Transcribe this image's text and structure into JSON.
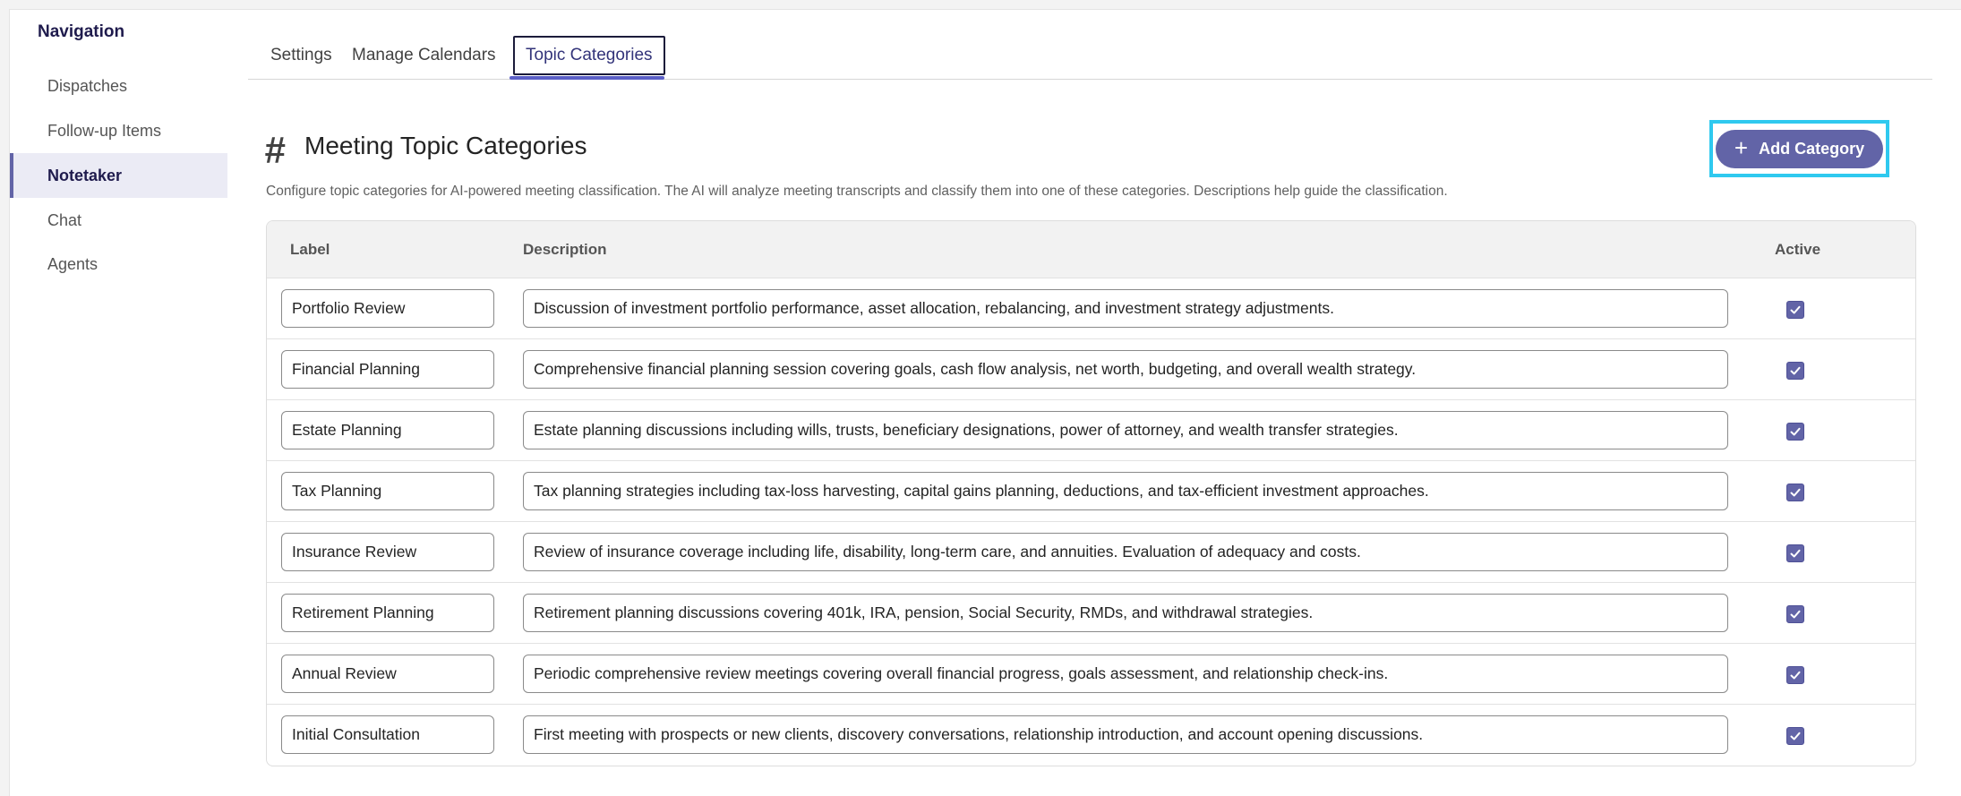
{
  "sidebar": {
    "title": "Navigation",
    "items": [
      {
        "label": "Dispatches"
      },
      {
        "label": "Follow-up Items"
      },
      {
        "label": "Notetaker"
      },
      {
        "label": "Chat"
      },
      {
        "label": "Agents"
      }
    ],
    "active": "Notetaker"
  },
  "tabs": [
    {
      "label": "Settings"
    },
    {
      "label": "Manage Calendars"
    },
    {
      "label": "Topic Categories"
    }
  ],
  "active_tab": "Topic Categories",
  "header": {
    "icon": "hash-icon",
    "hash_glyph": "#",
    "title": "Meeting Topic Categories",
    "description": "Configure topic categories for AI-powered meeting classification. The AI will analyze meeting transcripts and classify them into one of these categories. Descriptions help guide the classification.",
    "add_button": {
      "label": "Add Category",
      "icon": "plus-icon",
      "icon_glyph": "+"
    }
  },
  "table": {
    "columns": {
      "label": "Label",
      "description": "Description",
      "active": "Active"
    },
    "rows": [
      {
        "label": "Portfolio Review",
        "description": "Discussion of investment portfolio performance, asset allocation, rebalancing, and investment strategy adjustments.",
        "active": true
      },
      {
        "label": "Financial Planning",
        "description": "Comprehensive financial planning session covering goals, cash flow analysis, net worth, budgeting, and overall wealth strategy.",
        "active": true
      },
      {
        "label": "Estate Planning",
        "description": "Estate planning discussions including wills, trusts, beneficiary designations, power of attorney, and wealth transfer strategies.",
        "active": true
      },
      {
        "label": "Tax Planning",
        "description": "Tax planning strategies including tax-loss harvesting, capital gains planning, deductions, and tax-efficient investment approaches.",
        "active": true
      },
      {
        "label": "Insurance Review",
        "description": "Review of insurance coverage including life, disability, long-term care, and annuities. Evaluation of adequacy and costs.",
        "active": true
      },
      {
        "label": "Retirement Planning",
        "description": "Retirement planning discussions covering 401k, IRA, pension, Social Security, RMDs, and withdrawal strategies.",
        "active": true
      },
      {
        "label": "Annual Review",
        "description": "Periodic comprehensive review meetings covering overall financial progress, goals assessment, and relationship check-ins.",
        "active": true
      },
      {
        "label": "Initial Consultation",
        "description": "First meeting with prospects or new clients, discovery conversations, relationship introduction, and account opening discussions.",
        "active": true
      }
    ]
  },
  "colors": {
    "accent": "#6264a7",
    "focus_ring": "#2fc9ef",
    "nav_title": "#1f1b4d"
  }
}
